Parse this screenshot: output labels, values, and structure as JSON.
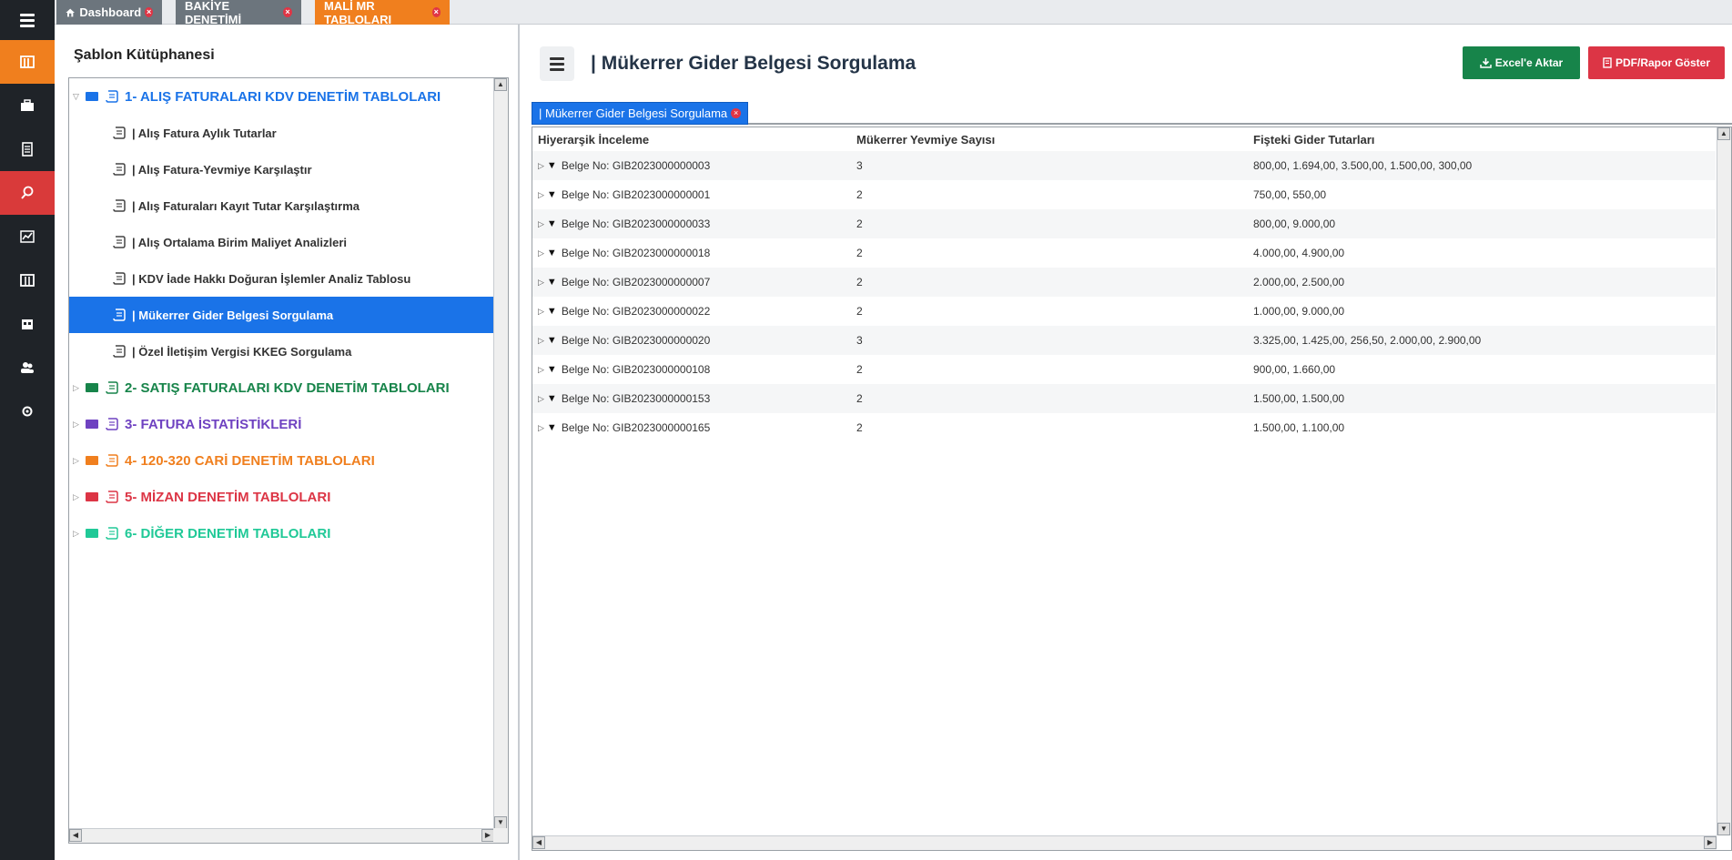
{
  "colors": {
    "accent_orange": "#f07f1e",
    "accent_red": "#d93a3a",
    "accent_blue": "#1a73e8",
    "excel_green": "#17844a",
    "pdf_red": "#dc3545"
  },
  "top_tabs": [
    {
      "label": "Dashboard",
      "icon": "home-icon"
    },
    {
      "label": "BAKİYE DENETİMİ"
    },
    {
      "label": "MALİ MR TABLOLARI"
    }
  ],
  "library": {
    "title": "Şablon Kütüphanesi",
    "categories": [
      {
        "label": "1- ALIŞ FATURALARI KDV DENETİM TABLOLARI",
        "color": "#1a73e8"
      },
      {
        "label": "2- SATIŞ FATURALARI KDV DENETİM TABLOLARI",
        "color": "#17844a"
      },
      {
        "label": "3- FATURA İSTATİSTİKLERİ",
        "color": "#6f42c1"
      },
      {
        "label": "4- 120-320 CARİ DENETİM TABLOLARI",
        "color": "#f07f1e"
      },
      {
        "label": "5- MİZAN DENETİM TABLOLARI",
        "color": "#dc3545"
      },
      {
        "label": "6- DİĞER DENETİM TABLOLARI",
        "color": "#20c997"
      }
    ],
    "items": [
      "| Alış Fatura Aylık Tutarlar",
      "| Alış Fatura-Yevmiye Karşılaştır",
      "| Alış Faturaları Kayıt Tutar Karşılaştırma",
      "| Alış Ortalama Birim Maliyet Analizleri",
      "| KDV İade Hakkı Doğuran İşlemler Analiz Tablosu",
      "| Mükerrer Gider Belgesi Sorgulama",
      "| Özel İletişim Vergisi KKEG Sorgulama"
    ]
  },
  "main": {
    "title": "| Mükerrer Gider Belgesi Sorgulama",
    "excel_label": "Excel'e Aktar",
    "pdf_label": "PDF/Rapor Göster",
    "tab_label": "| Mükerrer Gider Belgesi Sorgulama",
    "columns": [
      "Hiyerarşik İnceleme",
      "Mükerrer Yevmiye Sayısı",
      "Fişteki Gider Tutarları"
    ],
    "rows": [
      {
        "doc": "Belge No: GIB2023000000003",
        "count": "3",
        "amounts": "800,00, 1.694,00, 3.500,00, 1.500,00, 300,00"
      },
      {
        "doc": "Belge No: GIB2023000000001",
        "count": "2",
        "amounts": "750,00, 550,00"
      },
      {
        "doc": "Belge No: GIB2023000000033",
        "count": "2",
        "amounts": "800,00, 9.000,00"
      },
      {
        "doc": "Belge No: GIB2023000000018",
        "count": "2",
        "amounts": "4.000,00, 4.900,00"
      },
      {
        "doc": "Belge No: GIB2023000000007",
        "count": "2",
        "amounts": "2.000,00, 2.500,00"
      },
      {
        "doc": "Belge No: GIB2023000000022",
        "count": "2",
        "amounts": "1.000,00, 9.000,00"
      },
      {
        "doc": "Belge No: GIB2023000000020",
        "count": "3",
        "amounts": "3.325,00, 1.425,00, 256,50, 2.000,00, 2.900,00"
      },
      {
        "doc": "Belge No: GIB2023000000108",
        "count": "2",
        "amounts": "900,00, 1.660,00"
      },
      {
        "doc": "Belge No: GIB2023000000153",
        "count": "2",
        "amounts": "1.500,00, 1.500,00"
      },
      {
        "doc": "Belge No: GIB2023000000165",
        "count": "2",
        "amounts": "1.500,00, 1.100,00"
      }
    ]
  }
}
